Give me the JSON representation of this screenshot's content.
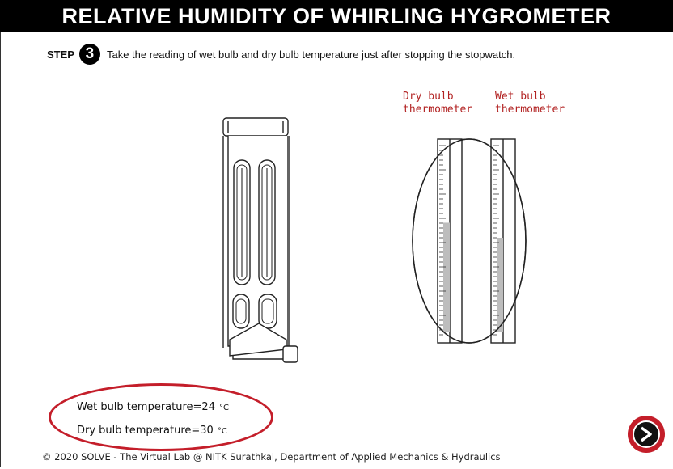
{
  "header": {
    "title": "RELATIVE HUMIDITY OF WHIRLING HYGROMETER"
  },
  "step": {
    "word": "STEP",
    "number": "3",
    "instruction": "Take the reading of wet bulb and dry bulb temperature just after stopping the stopwatch."
  },
  "labels": {
    "dry_bulb": [
      "Dry bulb",
      "thermometer"
    ],
    "wet_bulb": [
      "Wet bulb",
      "thermometer"
    ]
  },
  "readings": {
    "wet": {
      "label": "Wet bulb temperature=",
      "value": "24",
      "unit": "°C"
    },
    "dry": {
      "label": "Dry bulb temperature=",
      "value": "30",
      "unit": "°C"
    }
  },
  "footer": {
    "text": "© 2020 SOLVE - The Virtual Lab @ NITK Surathkal, Department of Applied Mechanics & Hydraulics"
  },
  "colors": {
    "accent": "#c41e2a",
    "label": "#b22222",
    "header_bg": "#000000",
    "mercury": "#bdbdbd"
  },
  "icons": {
    "next": "next-arrow-icon"
  },
  "thermometers": {
    "dry_fill_fraction": 0.58,
    "wet_fill_fraction": 0.5
  }
}
